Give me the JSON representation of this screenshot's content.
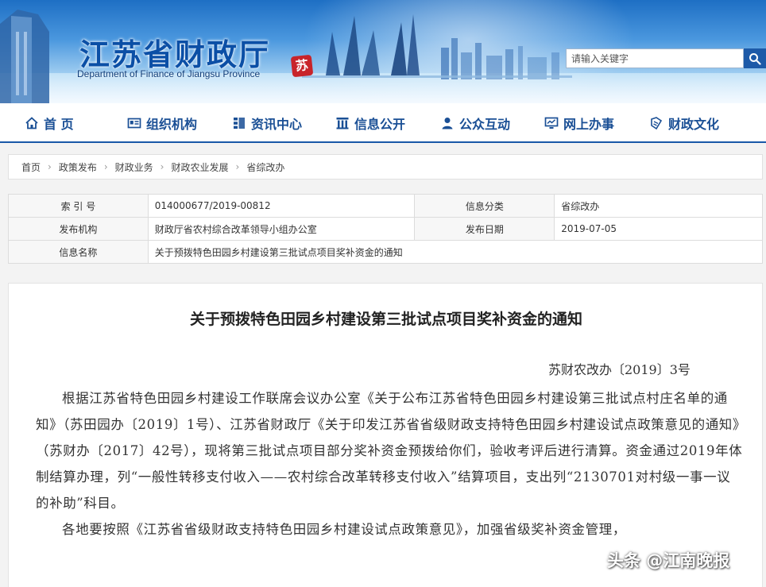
{
  "header": {
    "title_cn": "江苏省财政厅",
    "title_en": "Department of Finance of Jiangsu Province",
    "seal_char": "苏",
    "search": {
      "placeholder": "请输入关键字"
    }
  },
  "nav": {
    "items": [
      {
        "label": "首 页",
        "icon": "home-icon"
      },
      {
        "label": "组织机构",
        "icon": "id-card-icon"
      },
      {
        "label": "资讯中心",
        "icon": "list-icon"
      },
      {
        "label": "信息公开",
        "icon": "pillars-icon"
      },
      {
        "label": "公众互动",
        "icon": "user-icon"
      },
      {
        "label": "网上办事",
        "icon": "monitor-icon"
      },
      {
        "label": "财政文化",
        "icon": "book-icon"
      }
    ]
  },
  "breadcrumb": [
    "首页",
    "政策发布",
    "财政业务",
    "财政农业发展",
    "省综改办"
  ],
  "info": {
    "index_label": "索 引 号",
    "index_value": "014000677/2019-00812",
    "category_label": "信息分类",
    "category_value": "省综改办",
    "publisher_label": "发布机构",
    "publisher_value": "财政厅省农村综合改革领导小组办公室",
    "date_label": "发布日期",
    "date_value": "2019-07-05",
    "name_label": "信息名称",
    "name_value": "关于预拨特色田园乡村建设第三批试点项目奖补资金的通知"
  },
  "article": {
    "title": "关于预拨特色田园乡村建设第三批试点项目奖补资金的通知",
    "doc_no": "苏财农改办〔2019〕3号",
    "paragraphs": [
      "根据江苏省特色田园乡村建设工作联席会议办公室《关于公布江苏省特色田园乡村建设第三批试点村庄名单的通知》（苏田园办〔2019〕1号）、江苏省财政厅《关于印发江苏省省级财政支持特色田园乡村建设试点政策意见的通知》（苏财办〔2017〕42号），现将第三批试点项目部分奖补资金预拨给你们，验收考评后进行清算。资金通过2019年体制结算办理，列“一般性转移支付收入——农村综合改革转移支付收入”结算项目，支出列“2130701对村级一事一议的补助”科目。",
      "各地要按照《江苏省省级财政支持特色田园乡村建设试点政策意见》，加强省级奖补资金管理，"
    ]
  },
  "watermark": "头条 @江南晚报",
  "colors": {
    "nav_text": "#1a4f95",
    "title_blue": "#0b4fa6",
    "search_btn": "#1d5aa8"
  }
}
